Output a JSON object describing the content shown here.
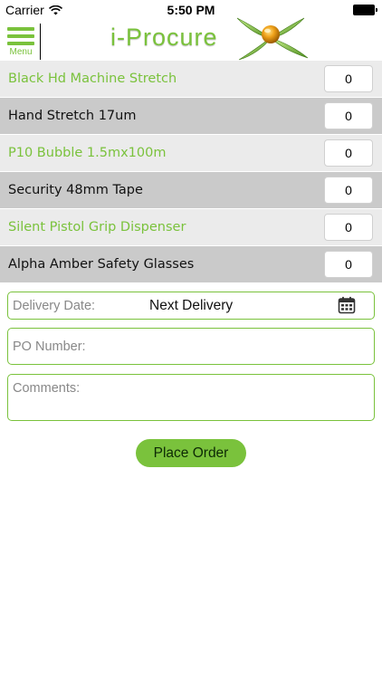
{
  "status_bar": {
    "carrier": "Carrier",
    "time": "5:50 PM"
  },
  "header": {
    "menu_label": "Menu",
    "logo_text": "i-Procure"
  },
  "products": [
    {
      "name": "Black Hd Machine Stretch",
      "quantity": "0"
    },
    {
      "name": "Hand Stretch 17um",
      "quantity": "0"
    },
    {
      "name": "P10 Bubble 1.5mx100m",
      "quantity": "0"
    },
    {
      "name": "Security 48mm Tape",
      "quantity": "0"
    },
    {
      "name": "Silent Pistol Grip Dispenser",
      "quantity": "0"
    },
    {
      "name": "Alpha Amber Safety Glasses",
      "quantity": "0"
    }
  ],
  "form": {
    "delivery_label": "Delivery Date:",
    "delivery_value": "Next Delivery",
    "po_placeholder": "PO Number:",
    "comments_placeholder": "Comments:"
  },
  "actions": {
    "place_order_label": "Place Order"
  },
  "colors": {
    "accent_green": "#7ac23c",
    "row_light": "#ebebeb",
    "row_dark": "#cacaca"
  }
}
